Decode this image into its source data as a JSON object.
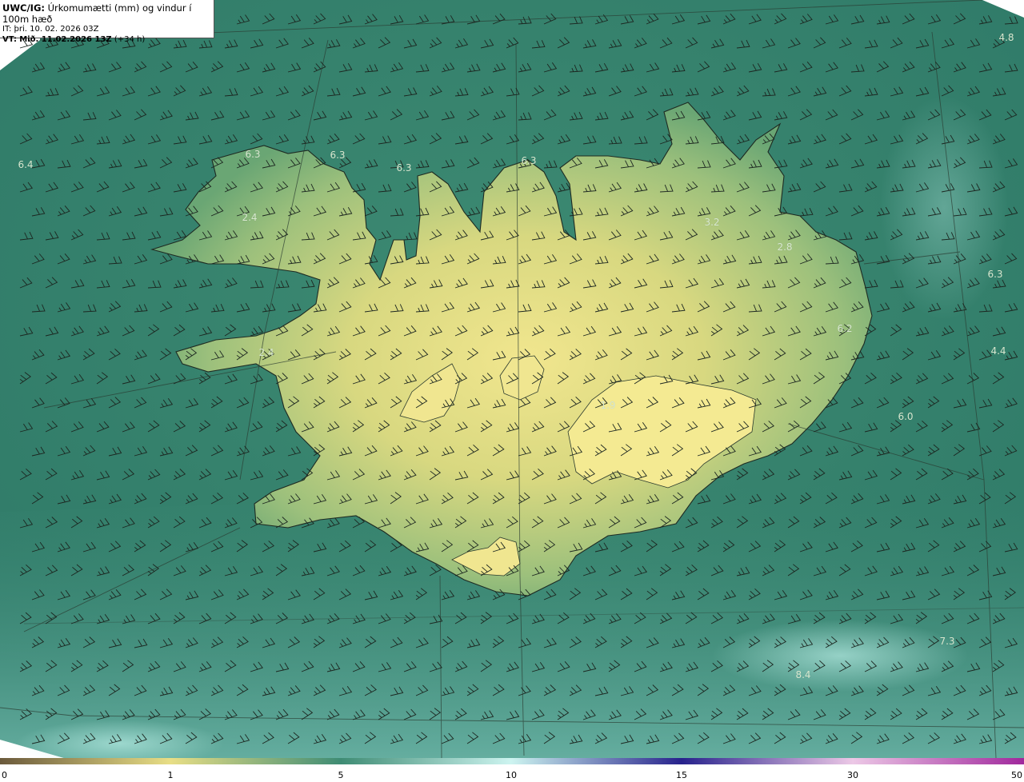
{
  "header": {
    "model": "UWC/IG:",
    "title": "Úrkomumætti (mm) og vindur í 100m hæð",
    "it_label": "IT:",
    "it_value": "þri. 10. 02. 2026 03Z",
    "vt_label": "VT:",
    "vt_value": "Mið. 11.02.2026 13Z",
    "vt_lead": "(+34 h)"
  },
  "value_labels": [
    {
      "id": "v1",
      "text": "4.8"
    },
    {
      "id": "v2",
      "text": "6.4"
    },
    {
      "id": "v3",
      "text": "6.3"
    },
    {
      "id": "v4",
      "text": "6.3"
    },
    {
      "id": "v5",
      "text": "6.3"
    },
    {
      "id": "v6",
      "text": "6.3"
    },
    {
      "id": "v7",
      "text": "2.4"
    },
    {
      "id": "v8",
      "text": "3.2"
    },
    {
      "id": "v9",
      "text": "2.8"
    },
    {
      "id": "v10",
      "text": "6.3"
    },
    {
      "id": "v11",
      "text": "6.2"
    },
    {
      "id": "v12",
      "text": "4.4"
    },
    {
      "id": "v13",
      "text": "2.4"
    },
    {
      "id": "v14",
      "text": "6.0"
    },
    {
      "id": "v15",
      "text": "1.9"
    },
    {
      "id": "v16",
      "text": "7.3"
    },
    {
      "id": "v17",
      "text": "8.4"
    }
  ],
  "colorbar": {
    "ticks": [
      "0",
      "1",
      "5",
      "10",
      "15",
      "30",
      "50"
    ],
    "colors": [
      "#6b5a3c",
      "#e8de86",
      "#3f8c74",
      "#cdf4f0",
      "#27228c",
      "#ecc8e6",
      "#a0289c"
    ]
  }
}
